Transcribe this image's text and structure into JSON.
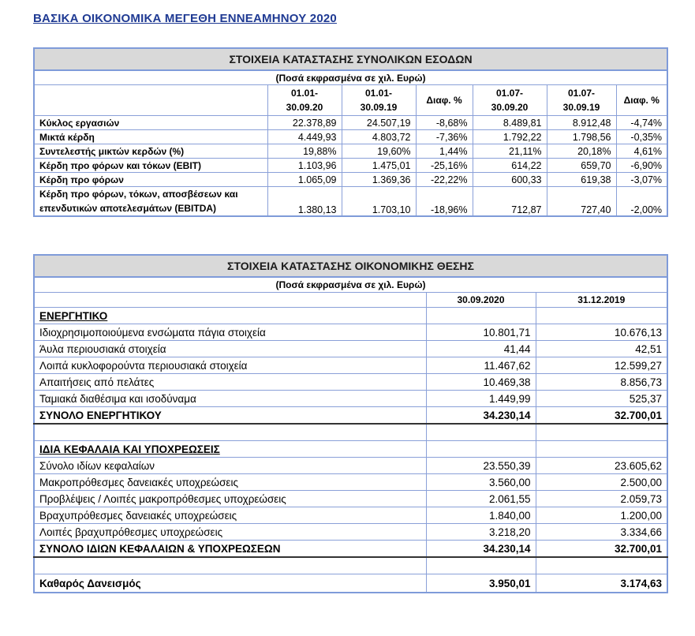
{
  "page_title": "ΒΑΣΙΚΑ ΟΙΚΟΝΟΜΙΚΑ ΜΕΓΕΘΗ ΕΝΝΕΑΜΗΝΟΥ 2020",
  "income": {
    "title": "ΣΤΟΙΧΕΙΑ ΚΑΤΑΣΤΑΣΗΣ ΣΥΝΟΛΙΚΩΝ ΕΣΟΔΩΝ",
    "subtitle": "(Ποσά εκφρασμένα σε χιλ. Ευρώ)",
    "headers": [
      [
        "01.01-",
        "30.09.20"
      ],
      [
        "01.01-",
        "30.09.19"
      ],
      [
        "Διαφ. %"
      ],
      [
        "01.07-",
        "30.09.20"
      ],
      [
        "01.07-",
        "30.09.19"
      ],
      [
        "Διαφ. %"
      ]
    ],
    "rows": [
      {
        "label": "Κύκλος εργασιών",
        "values": [
          "22.378,89",
          "24.507,19",
          "-8,68%",
          "8.489,81",
          "8.912,48",
          "-4,74%"
        ]
      },
      {
        "label": "Μικτά κέρδη",
        "values": [
          "4.449,93",
          "4.803,72",
          "-7,36%",
          "1.792,22",
          "1.798,56",
          "-0,35%"
        ]
      },
      {
        "label": "Συντελεστής μικτών κερδών (%)",
        "values": [
          "19,88%",
          "19,60%",
          "1,44%",
          "21,11%",
          "20,18%",
          "4,61%"
        ]
      },
      {
        "label": "Κέρδη προ φόρων  και τόκων (EBIT)",
        "values": [
          "1.103,96",
          "1.475,01",
          "-25,16%",
          "614,22",
          "659,70",
          "-6,90%"
        ]
      },
      {
        "label": "Κέρδη προ φόρων",
        "values": [
          "1.065,09",
          "1.369,36",
          "-22,22%",
          "600,33",
          "619,38",
          "-3,07%"
        ]
      }
    ],
    "last_row": {
      "label_line1": "Κέρδη προ φόρων, τόκων, αποσβέσεων και",
      "label_line2": "επενδυτικών αποτελεσμάτων (EBITDA)",
      "values": [
        "1.380,13",
        "1.703,10",
        "-18,96%",
        "712,87",
        "727,40",
        "-2,00%"
      ]
    }
  },
  "balance": {
    "title": "ΣΤΟΙΧΕΙΑ ΚΑΤΑΣΤΑΣΗΣ ΟΙΚΟΝΟΜΙΚΗΣ ΘΕΣΗΣ",
    "subtitle": "(Ποσά εκφρασμένα σε χιλ. Ευρώ)",
    "col1": "30.09.2020",
    "col2": "31.12.2019",
    "assets_heading": "ΕΝΕΡΓΗΤΙΚΟ",
    "assets": [
      {
        "label": "Ιδιοχρησιμοποιούμενα ενσώματα πάγια στοιχεία",
        "v1": "10.801,71",
        "v2": "10.676,13"
      },
      {
        "label": "Άυλα περιουσιακά στοιχεία",
        "v1": "41,44",
        "v2": "42,51"
      },
      {
        "label": "Λοιπά κυκλοφορούντα περιουσιακά στοιχεία",
        "v1": "11.467,62",
        "v2": "12.599,27"
      },
      {
        "label": "Απαιτήσεις από πελάτες",
        "v1": "10.469,38",
        "v2": "8.856,73"
      },
      {
        "label": "Ταμιακά διαθέσιμα και ισοδύναμα",
        "v1": "1.449,99",
        "v2": "525,37"
      }
    ],
    "assets_total": {
      "label": "ΣΥΝΟΛΟ ΕΝΕΡΓΗΤΙΚΟΥ",
      "v1": "34.230,14",
      "v2": "32.700,01"
    },
    "liab_heading": "ΙΔΙΑ ΚΕΦΑΛΑΙΑ ΚΑΙ ΥΠΟΧΡΕΩΣΕΙΣ",
    "liabilities": [
      {
        "label": "Σύνολο ιδίων κεφαλαίων",
        "v1": "23.550,39",
        "v2": "23.605,62"
      },
      {
        "label": "Μακροπρόθεσμες δανειακές υποχρεώσεις",
        "v1": "3.560,00",
        "v2": "2.500,00"
      },
      {
        "label": "Προβλέψεις / Λοιπές μακροπρόθεσμες υποχρεώσεις",
        "v1": "2.061,55",
        "v2": "2.059,73"
      },
      {
        "label": "Βραχυπρόθεσμες δανειακές υποχρεώσεις",
        "v1": "1.840,00",
        "v2": "1.200,00"
      },
      {
        "label": "Λοιπές βραχυπρόθεσμες υποχρεώσεις",
        "v1": "3.218,20",
        "v2": "3.334,66"
      }
    ],
    "liab_total": {
      "label": "ΣΥΝΟΛΟ ΙΔΙΩΝ ΚΕΦΑΛΑΙΩΝ  & ΥΠΟΧΡΕΩΣΕΩΝ",
      "v1": "34.230,14",
      "v2": "32.700,01"
    },
    "net_debt": {
      "label": "Καθαρός Δανεισμός",
      "v1": "3.950,01",
      "v2": "3.174,63"
    }
  }
}
